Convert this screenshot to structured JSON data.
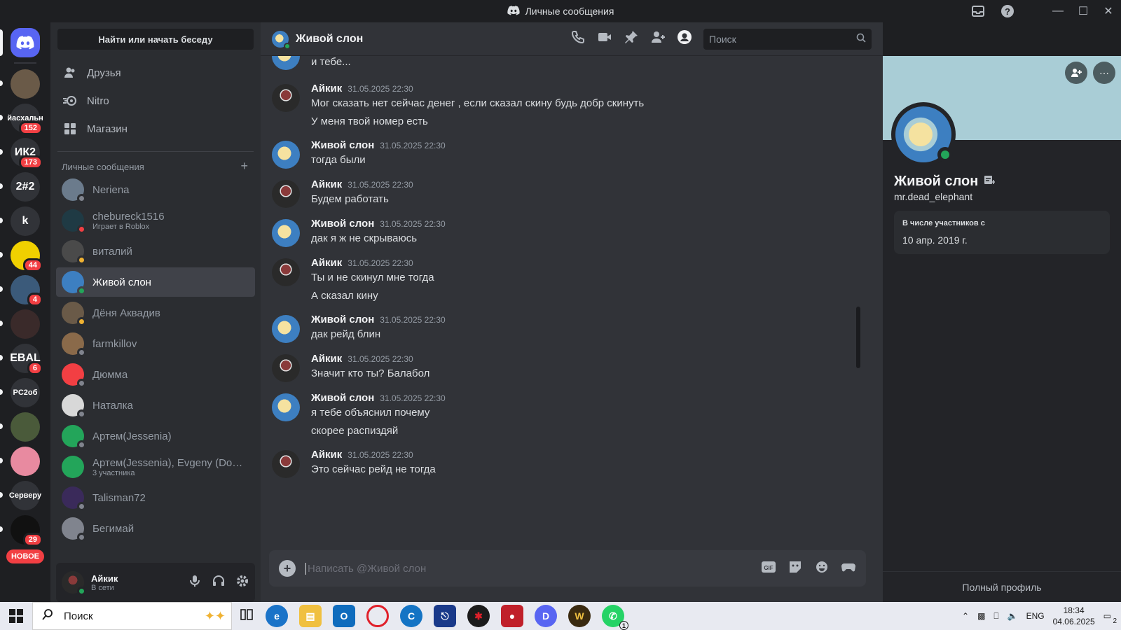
{
  "window": {
    "title": "Личные сообщения"
  },
  "guilds": [
    {
      "label": "",
      "color": "#6a5a48",
      "badge": ""
    },
    {
      "label": "йасхальн",
      "color": "#313338",
      "badge": "152"
    },
    {
      "label": "ИК2",
      "color": "#313338",
      "badge": "173"
    },
    {
      "label": "2#2",
      "color": "#313338",
      "badge": ""
    },
    {
      "label": "k",
      "color": "#313338",
      "badge": ""
    },
    {
      "label": "",
      "color": "#f0d000",
      "badge": "44"
    },
    {
      "label": "",
      "color": "#3b5a7a",
      "badge": "4"
    },
    {
      "label": "",
      "color": "#3a2a2a",
      "badge": ""
    },
    {
      "label": "EBAL",
      "color": "#313338",
      "badge": "6"
    },
    {
      "label": "PC2об",
      "color": "#313338",
      "badge": ""
    },
    {
      "label": "",
      "color": "#4a5a3a",
      "badge": ""
    },
    {
      "label": "",
      "color": "#e88aa0",
      "badge": ""
    },
    {
      "label": "Серверу",
      "color": "#313338",
      "badge": ""
    },
    {
      "label": "",
      "color": "#111111",
      "badge": "29"
    }
  ],
  "guild_new_label": "НОВОЕ",
  "sidebar": {
    "search_label": "Найти или начать беседу",
    "nav": [
      {
        "label": "Друзья",
        "icon": "friends-icon"
      },
      {
        "label": "Nitro",
        "icon": "nitro-icon"
      },
      {
        "label": "Магазин",
        "icon": "shop-icon"
      }
    ],
    "dm_header": "Личные сообщения",
    "dms": [
      {
        "name": "Neriena",
        "sub": "",
        "status": "off",
        "color": "#6b7b8c"
      },
      {
        "name": "chebureck1516",
        "sub": "Играет в Roblox",
        "status": "dnd",
        "color": "#1f3a44"
      },
      {
        "name": "виталий",
        "sub": "",
        "status": "idle",
        "color": "#4a4a4a"
      },
      {
        "name": "Живой слон",
        "sub": "",
        "status": "on",
        "color": "#3d7fc1"
      },
      {
        "name": "Дёня Аквадив",
        "sub": "",
        "status": "idle",
        "color": "#6a5a48"
      },
      {
        "name": "farmkillov",
        "sub": "",
        "status": "off",
        "color": "#8a6a4a"
      },
      {
        "name": "Дюмма",
        "sub": "",
        "status": "off",
        "color": "#f23f43"
      },
      {
        "name": "Наталка",
        "sub": "",
        "status": "off",
        "color": "#d8d8d8"
      },
      {
        "name": "Артем(Jessenia)",
        "sub": "",
        "status": "off",
        "color": "#23a55a"
      },
      {
        "name": "Артем(Jessenia), Evgeny (Dou...",
        "sub": "3 участника",
        "status": "",
        "color": "#23a55a"
      },
      {
        "name": "Talisman72",
        "sub": "",
        "status": "off",
        "color": "#3a2a5a"
      },
      {
        "name": "Бегимай",
        "sub": "",
        "status": "off",
        "color": "#80848e"
      }
    ]
  },
  "user": {
    "name": "Айкик",
    "status": "В сети"
  },
  "chat": {
    "name": "Живой слон",
    "search_placeholder": "Поиск",
    "composer_placeholder": "Написать @Живой слон",
    "partial_line": "и тебе...",
    "messages": [
      {
        "author": "Айкик",
        "time": "31.05.2025 22:30",
        "lines": [
          "Мог сказать нет сейчас денег , если сказал скину будь добр скинуть",
          "У меня твой номер есть"
        ],
        "avatar": "dark"
      },
      {
        "author": "Живой слон",
        "time": "31.05.2025 22:30",
        "lines": [
          "тогда были"
        ],
        "avatar": "elephant"
      },
      {
        "author": "Айкик",
        "time": "31.05.2025 22:30",
        "lines": [
          "Будем работать"
        ],
        "avatar": "dark"
      },
      {
        "author": "Живой слон",
        "time": "31.05.2025 22:30",
        "lines": [
          "дак я ж не скрываюсь"
        ],
        "avatar": "elephant"
      },
      {
        "author": "Айкик",
        "time": "31.05.2025 22:30",
        "lines": [
          "Ты и не скинул мне тогда",
          "А сказал кину"
        ],
        "avatar": "dark"
      },
      {
        "author": "Живой слон",
        "time": "31.05.2025 22:30",
        "lines": [
          "дак рейд блин"
        ],
        "avatar": "elephant"
      },
      {
        "author": "Айкик",
        "time": "31.05.2025 22:30",
        "lines": [
          "Значит кто ты? Балабол"
        ],
        "avatar": "dark"
      },
      {
        "author": "Живой слон",
        "time": "31.05.2025 22:30",
        "lines": [
          "я тебе объяснил почему",
          "скорее распиздяй"
        ],
        "avatar": "elephant"
      },
      {
        "author": "Айкик",
        "time": "31.05.2025 22:30",
        "lines": [
          "Это сейчас рейд не тогда"
        ],
        "avatar": "dark"
      }
    ]
  },
  "profile": {
    "display_name": "Живой слон",
    "username": "mr.dead_elephant",
    "member_since_label": "В числе участников с",
    "member_since": "10 апр. 2019 г.",
    "full_profile": "Полный профиль",
    "banner_color": "#a9cdd6"
  },
  "taskbar": {
    "search_label": "Поиск",
    "lang": "ENG",
    "time": "18:34",
    "date": "04.06.2025",
    "notif_count": "2",
    "whatsapp_badge": "1"
  }
}
